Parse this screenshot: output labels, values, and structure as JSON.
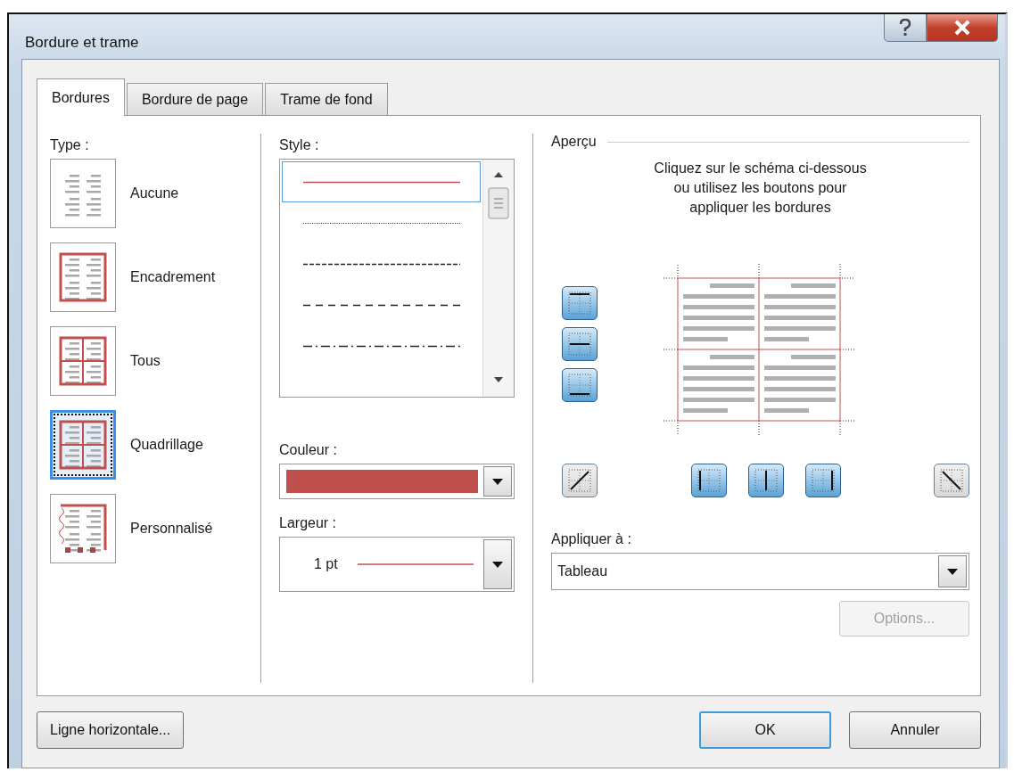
{
  "window": {
    "title": "Bordure et trame"
  },
  "tabs": [
    {
      "label": "Bordures",
      "selected": true
    },
    {
      "label": "Bordure de page",
      "selected": false
    },
    {
      "label": "Trame de fond",
      "selected": false
    }
  ],
  "type": {
    "label": "Type :",
    "items": [
      {
        "kind": "none",
        "label": "Aucune",
        "selected": false
      },
      {
        "kind": "box",
        "label": "Encadrement",
        "selected": false
      },
      {
        "kind": "all",
        "label": "Tous",
        "selected": false
      },
      {
        "kind": "grid",
        "label": "Quadrillage",
        "selected": true
      },
      {
        "kind": "custom",
        "label": "Personnalisé",
        "selected": false
      }
    ]
  },
  "style": {
    "label": "Style :",
    "lines": [
      {
        "kind": "solid",
        "selected": true
      },
      {
        "kind": "dotted",
        "selected": false
      },
      {
        "kind": "dashed",
        "selected": false
      },
      {
        "kind": "dashed-wide",
        "selected": false
      },
      {
        "kind": "dash-dot",
        "selected": false
      }
    ]
  },
  "color": {
    "label": "Couleur :",
    "color": "#c0504d"
  },
  "width": {
    "label": "Largeur :",
    "value": "1 pt"
  },
  "preview": {
    "title": "Aperçu",
    "instructions": [
      "Cliquez sur le schéma ci-dessous",
      "ou utilisez les boutons pour",
      "appliquer les bordures"
    ],
    "side_buttons": [
      {
        "kind": "top",
        "on": true
      },
      {
        "kind": "inside-h",
        "on": true
      },
      {
        "kind": "bottom",
        "on": true
      }
    ],
    "bottom_buttons": [
      {
        "kind": "diag-up",
        "on": false
      },
      {
        "kind": "left",
        "on": true
      },
      {
        "kind": "inside-v",
        "on": true
      },
      {
        "kind": "right",
        "on": true
      },
      {
        "kind": "diag-down",
        "on": false
      }
    ]
  },
  "apply_to": {
    "label": "Appliquer à :",
    "value": "Tableau"
  },
  "options_button": {
    "label": "Options...",
    "disabled": true
  },
  "footer": {
    "left_button": {
      "label": "Ligne horizontale..."
    },
    "buttons": [
      {
        "label": "OK",
        "default": true
      },
      {
        "label": "Annuler",
        "default": false
      }
    ]
  }
}
